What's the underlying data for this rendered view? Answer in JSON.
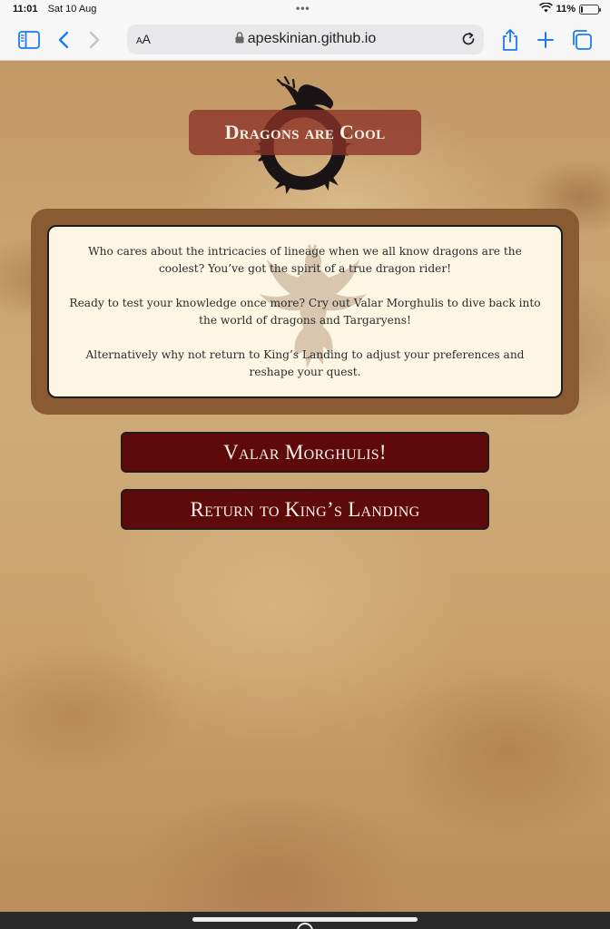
{
  "status_bar": {
    "time": "11:01",
    "date": "Sat 10 Aug",
    "battery_percent": "11%",
    "battery_level": 0.11
  },
  "browser": {
    "text_size_label_small": "A",
    "text_size_label_large": "A",
    "url": "apeskinian.github.io",
    "accent_color": "#1a7cf5"
  },
  "page": {
    "title": "Dragons are Cool",
    "paragraphs": [
      "Who cares about the intricacies of lineage when we all know dragons are the coolest? You’ve got the spirit of a true dragon rider!",
      "Ready to test your knowledge once more? Cry out Valar Morghulis to dive back into the world of dragons and Targaryens!",
      "Alternatively why not return to King’s Landing to adjust your preferences and reshape your quest."
    ],
    "buttons": {
      "retry_label": "Valar Morghulis!",
      "home_label": "Return to King’s Landing"
    },
    "colors": {
      "title_bg": "#8c3228",
      "button_bg": "#5e0a0a",
      "card_frame": "#8a5a33",
      "card_bg": "#fdf6e3"
    }
  }
}
